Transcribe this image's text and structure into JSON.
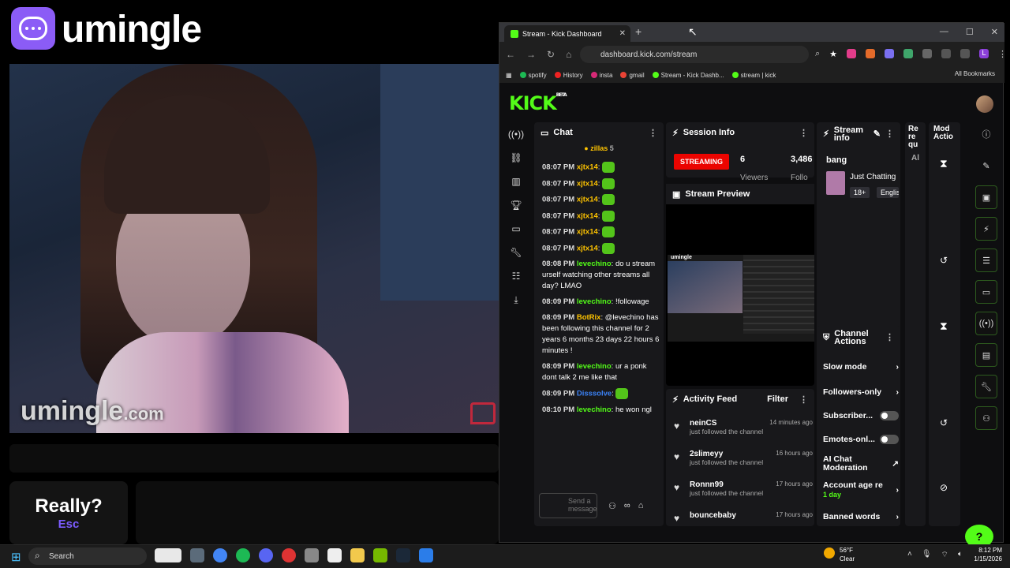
{
  "app": {
    "name": "umingle",
    "watermark": "umingle",
    "watermark_suffix": ".com",
    "really_label": "Really?",
    "esc_label": "Esc"
  },
  "browser": {
    "tab_title": "Stream - Kick Dashboard",
    "url": "dashboard.kick.com/stream",
    "bookmarks": [
      "spotify",
      "History",
      "insta",
      "gmail",
      "Stream - Kick Dashb...",
      "stream | kick"
    ],
    "all_bookmarks": "All Bookmarks"
  },
  "kick": {
    "logo": "KICK",
    "beta": "BETA",
    "chat": {
      "title": "Chat",
      "pinned": "zillas",
      "pinned_count": "5",
      "input_placeholder": "Send a message",
      "messages": [
        {
          "time": "08:07 PM",
          "user": "xjtx14",
          "text": "",
          "color": "#ffc400",
          "emote": true
        },
        {
          "time": "08:07 PM",
          "user": "xjtx14",
          "text": "",
          "color": "#ffc400",
          "emote": true
        },
        {
          "time": "08:07 PM",
          "user": "xjtx14",
          "text": "",
          "color": "#ffc400",
          "emote": true
        },
        {
          "time": "08:07 PM",
          "user": "xjtx14",
          "text": "",
          "color": "#ffc400",
          "emote": true
        },
        {
          "time": "08:07 PM",
          "user": "xjtx14",
          "text": "",
          "color": "#ffc400",
          "emote": true
        },
        {
          "time": "08:07 PM",
          "user": "xjtx14",
          "text": "",
          "color": "#ffc400",
          "emote": true
        },
        {
          "time": "08:08 PM",
          "user": "levechino",
          "text": "do u stream urself watching other streams all day? LMAO",
          "color": "#53fc18",
          "emote": false
        },
        {
          "time": "08:09 PM",
          "user": "levechino",
          "text": "!followage",
          "color": "#53fc18",
          "emote": false
        },
        {
          "time": "08:09 PM",
          "user": "BotRix",
          "text": "@levechino has been following this channel for 2 years 6 months 23 days 22 hours 6 minutes !",
          "color": "#ffc400",
          "emote": false
        },
        {
          "time": "08:09 PM",
          "user": "levechino",
          "text": "ur a ponk dont talk 2 me like that",
          "color": "#53fc18",
          "emote": false
        },
        {
          "time": "08:09 PM",
          "user": "Disssolve",
          "text": "",
          "color": "#3b82f6",
          "emote": true
        },
        {
          "time": "08:10 PM",
          "user": "levechino",
          "text": "he won ngl",
          "color": "#53fc18",
          "emote": false
        }
      ]
    },
    "session": {
      "title": "Session Info",
      "status": "STREAMING",
      "viewers": "6",
      "viewers_label": "Viewers",
      "followers": "3,486",
      "followers_label": "Follo"
    },
    "preview": {
      "title": "Stream Preview",
      "label": "umingle"
    },
    "activity": {
      "title": "Activity Feed",
      "filter": "Filter",
      "items": [
        {
          "name": "neinCS",
          "time": "14 minutes ago",
          "action": "just followed the channel"
        },
        {
          "name": "2slimeyy",
          "time": "16 hours ago",
          "action": "just followed the channel"
        },
        {
          "name": "Ronnn99",
          "time": "17 hours ago",
          "action": "just followed the channel"
        },
        {
          "name": "bouncebaby",
          "time": "17 hours ago",
          "action": ""
        }
      ]
    },
    "stream_info": {
      "title": "Stream info",
      "stream_title": "bang",
      "category": "Just Chatting",
      "tag1": "18+",
      "tag2": "English"
    },
    "recent": {
      "title": "Re re qu",
      "sub": "Al"
    },
    "mod": {
      "title": "Mod Actio"
    },
    "channel_actions": {
      "title": "Channel Actions",
      "items": [
        {
          "label": "Slow mode",
          "kind": "chevron"
        },
        {
          "label": "Followers-only",
          "kind": "chevron"
        },
        {
          "label": "Subscriber...",
          "kind": "toggle"
        },
        {
          "label": "Emotes-onl...",
          "kind": "toggle"
        },
        {
          "label": "AI Chat Moderation",
          "kind": "external"
        },
        {
          "label": "Account age re",
          "kind": "chevron",
          "sub": "1 day"
        },
        {
          "label": "Banned words",
          "kind": "chevron"
        }
      ]
    }
  },
  "taskbar": {
    "search": "Search",
    "temp": "56°F",
    "weather": "Clear",
    "time": "8:12 PM",
    "date": "1/15/2026"
  }
}
